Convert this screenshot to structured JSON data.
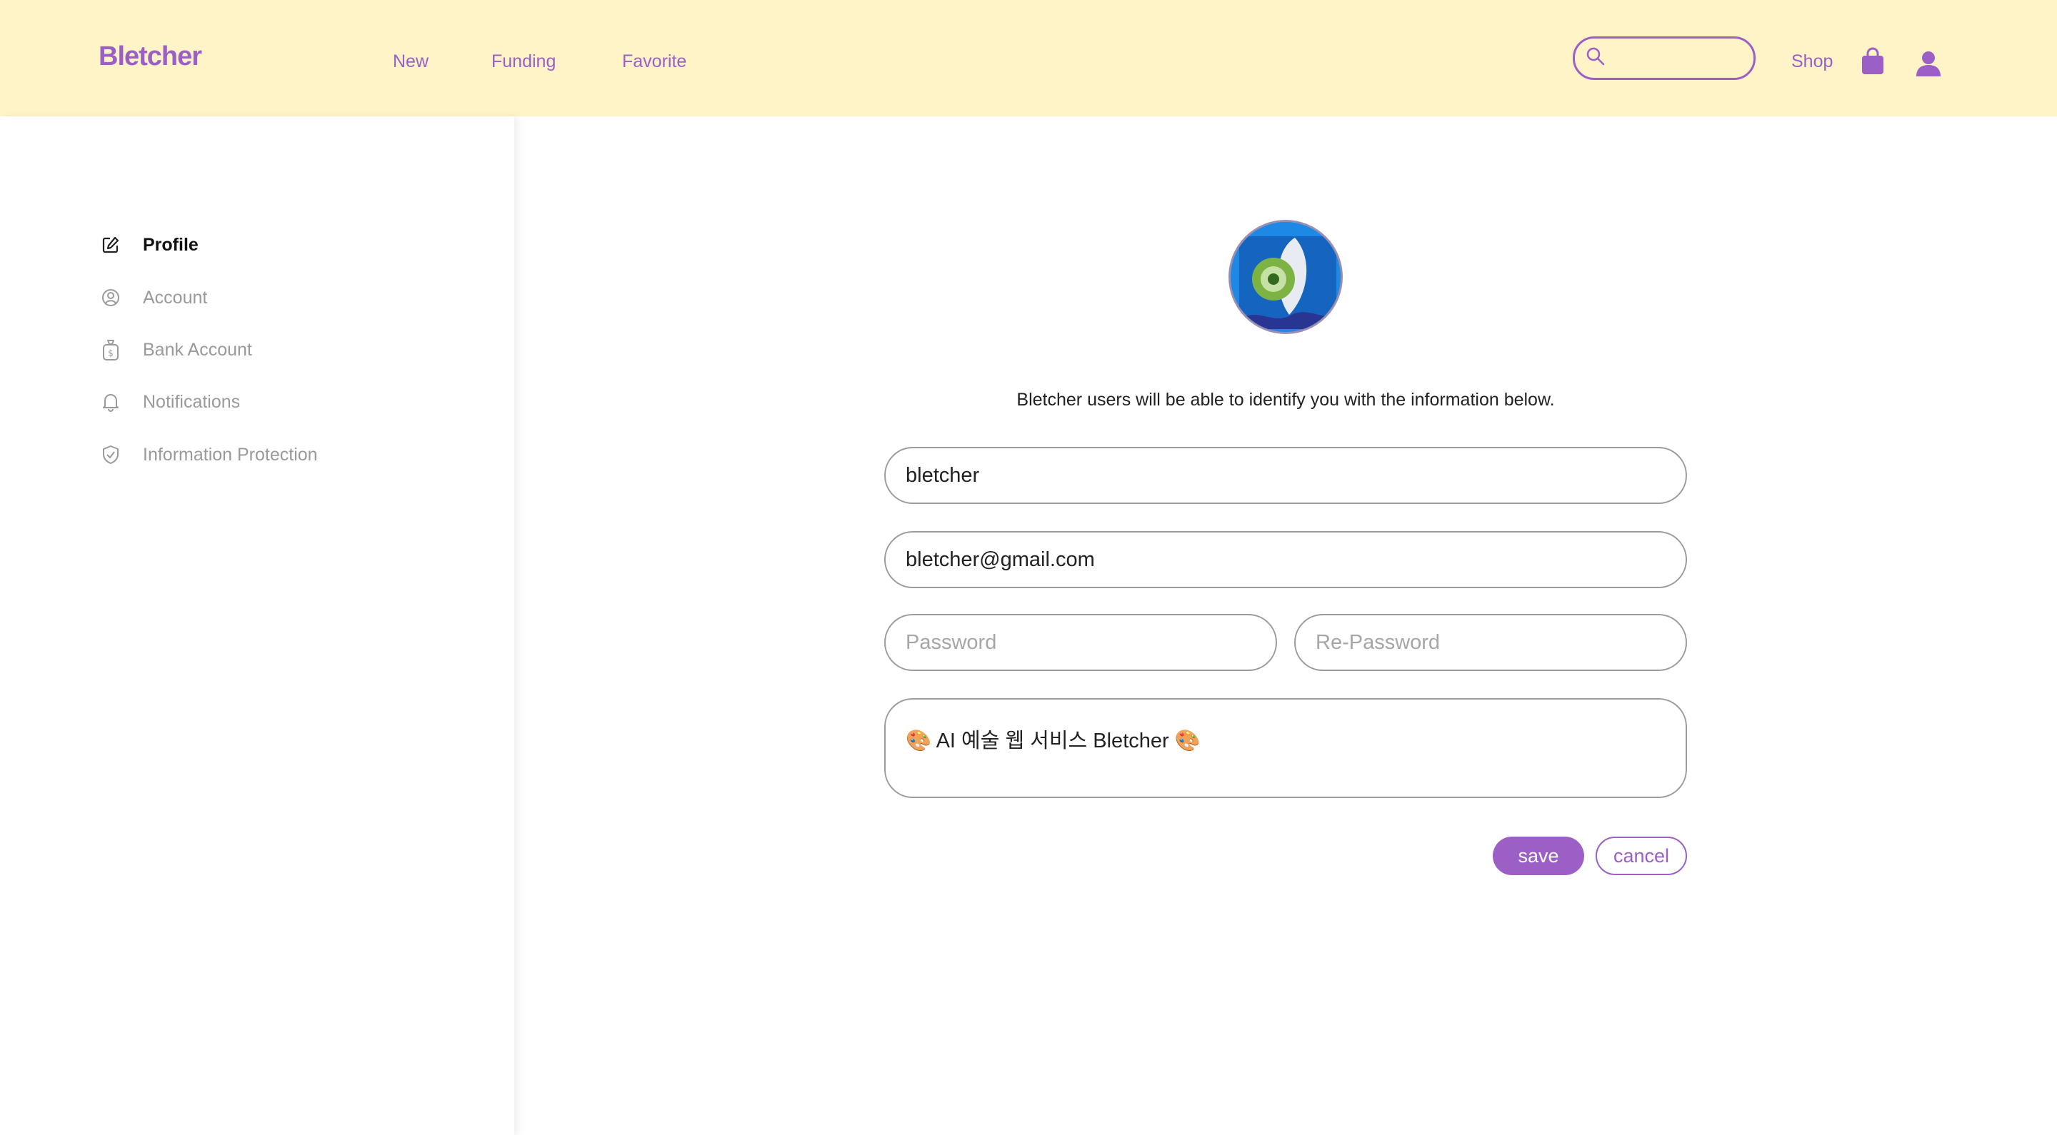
{
  "brand": {
    "name": "Bletcher",
    "accent": "#9b5fc5",
    "header_bg": "#fff3c8"
  },
  "nav": {
    "links": [
      {
        "label": "New"
      },
      {
        "label": "Funding"
      },
      {
        "label": "Favorite"
      }
    ],
    "search": {
      "value": "",
      "icon": "search-icon"
    },
    "shop_label": "Shop",
    "cart_icon": "shopping-bag-icon",
    "user_icon": "user-icon"
  },
  "sidebar": {
    "items": [
      {
        "label": "Profile",
        "icon": "edit-icon",
        "active": true
      },
      {
        "label": "Account",
        "icon": "account-circle-icon",
        "active": false
      },
      {
        "label": "Bank Account",
        "icon": "money-bag-icon",
        "active": false
      },
      {
        "label": "Notifications",
        "icon": "bell-icon",
        "active": false
      },
      {
        "label": "Information Protection",
        "icon": "shield-icon",
        "active": false
      }
    ]
  },
  "profile": {
    "info_text": "Bletcher users will be able to identify you with the information below.",
    "username": "bletcher",
    "email": "bletcher@gmail.com",
    "password_placeholder": "Password",
    "repassword_placeholder": "Re-Password",
    "bio": "🎨 AI 예술 웹 서비스 Bletcher 🎨",
    "save_label": "save",
    "cancel_label": "cancel"
  }
}
